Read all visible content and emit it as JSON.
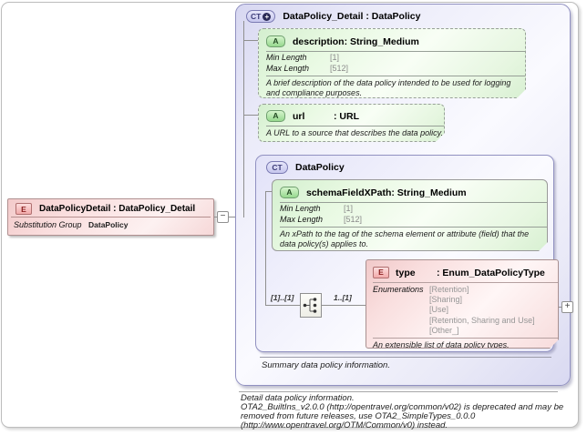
{
  "palette": {
    "attribute_green": "#e8f9e2",
    "complex_lavender": "#ebebf9",
    "element_pink": "#f9dede",
    "connector_gray": "#8f8f8f"
  },
  "icons": {
    "collapse": "−",
    "expand": "+",
    "ct_plus": "+"
  },
  "element": {
    "badge": "E",
    "title": "DataPolicyDetail : DataPolicy_Detail",
    "fact_label": "Substitution Group",
    "fact_value": "DataPolicy"
  },
  "main": {
    "badge": "CT",
    "title": "DataPolicy_Detail : DataPolicy",
    "summary_doc": "Summary data policy information.",
    "attributes": [
      {
        "badge": "A",
        "name": "description",
        "type": ": String_Medium",
        "facts": [
          {
            "label": "Min Length",
            "value": "[1]"
          },
          {
            "label": "Max Length",
            "value": "[512]"
          }
        ],
        "doc": "A brief description of the data policy intended to be used for logging and compliance purposes."
      },
      {
        "badge": "A",
        "name": "url",
        "type": ": URL",
        "doc": "A URL to a source that describes the data policy."
      }
    ],
    "base": {
      "badge": "CT",
      "title": "DataPolicy",
      "attribute": {
        "badge": "A",
        "name": "schemaFieldXPath",
        "type": ": String_Medium",
        "facts": [
          {
            "label": "Min Length",
            "value": "[1]"
          },
          {
            "label": "Max Length",
            "value": "[512]"
          }
        ],
        "doc": "An xPath to the tag of the schema element or attribute (field) that the data policy(s) applies to."
      },
      "cardinality_left": "[1]..[1]",
      "cardinality_right": "1..[1]",
      "type_element": {
        "badge": "E",
        "name": "type",
        "type": ": Enum_DataPolicyType",
        "fact_label": "Enumerations",
        "values": [
          "[Retention]",
          "[Sharing]",
          "[Use]",
          "[Retention, Sharing and Use]",
          "[Other_]"
        ],
        "doc": "An extensible list of data policy types."
      }
    }
  },
  "footer": {
    "lines": [
      "Detail data policy information.",
      "OTA2_BuiltIns_v2.0.0 (http://opentravel.org/common/v02) is deprecated and may be",
      "removed from future releases, use OTA2_SimpleTypes_0.0.0",
      "(http://www.opentravel.org/OTM/Common/v0) instead."
    ]
  }
}
